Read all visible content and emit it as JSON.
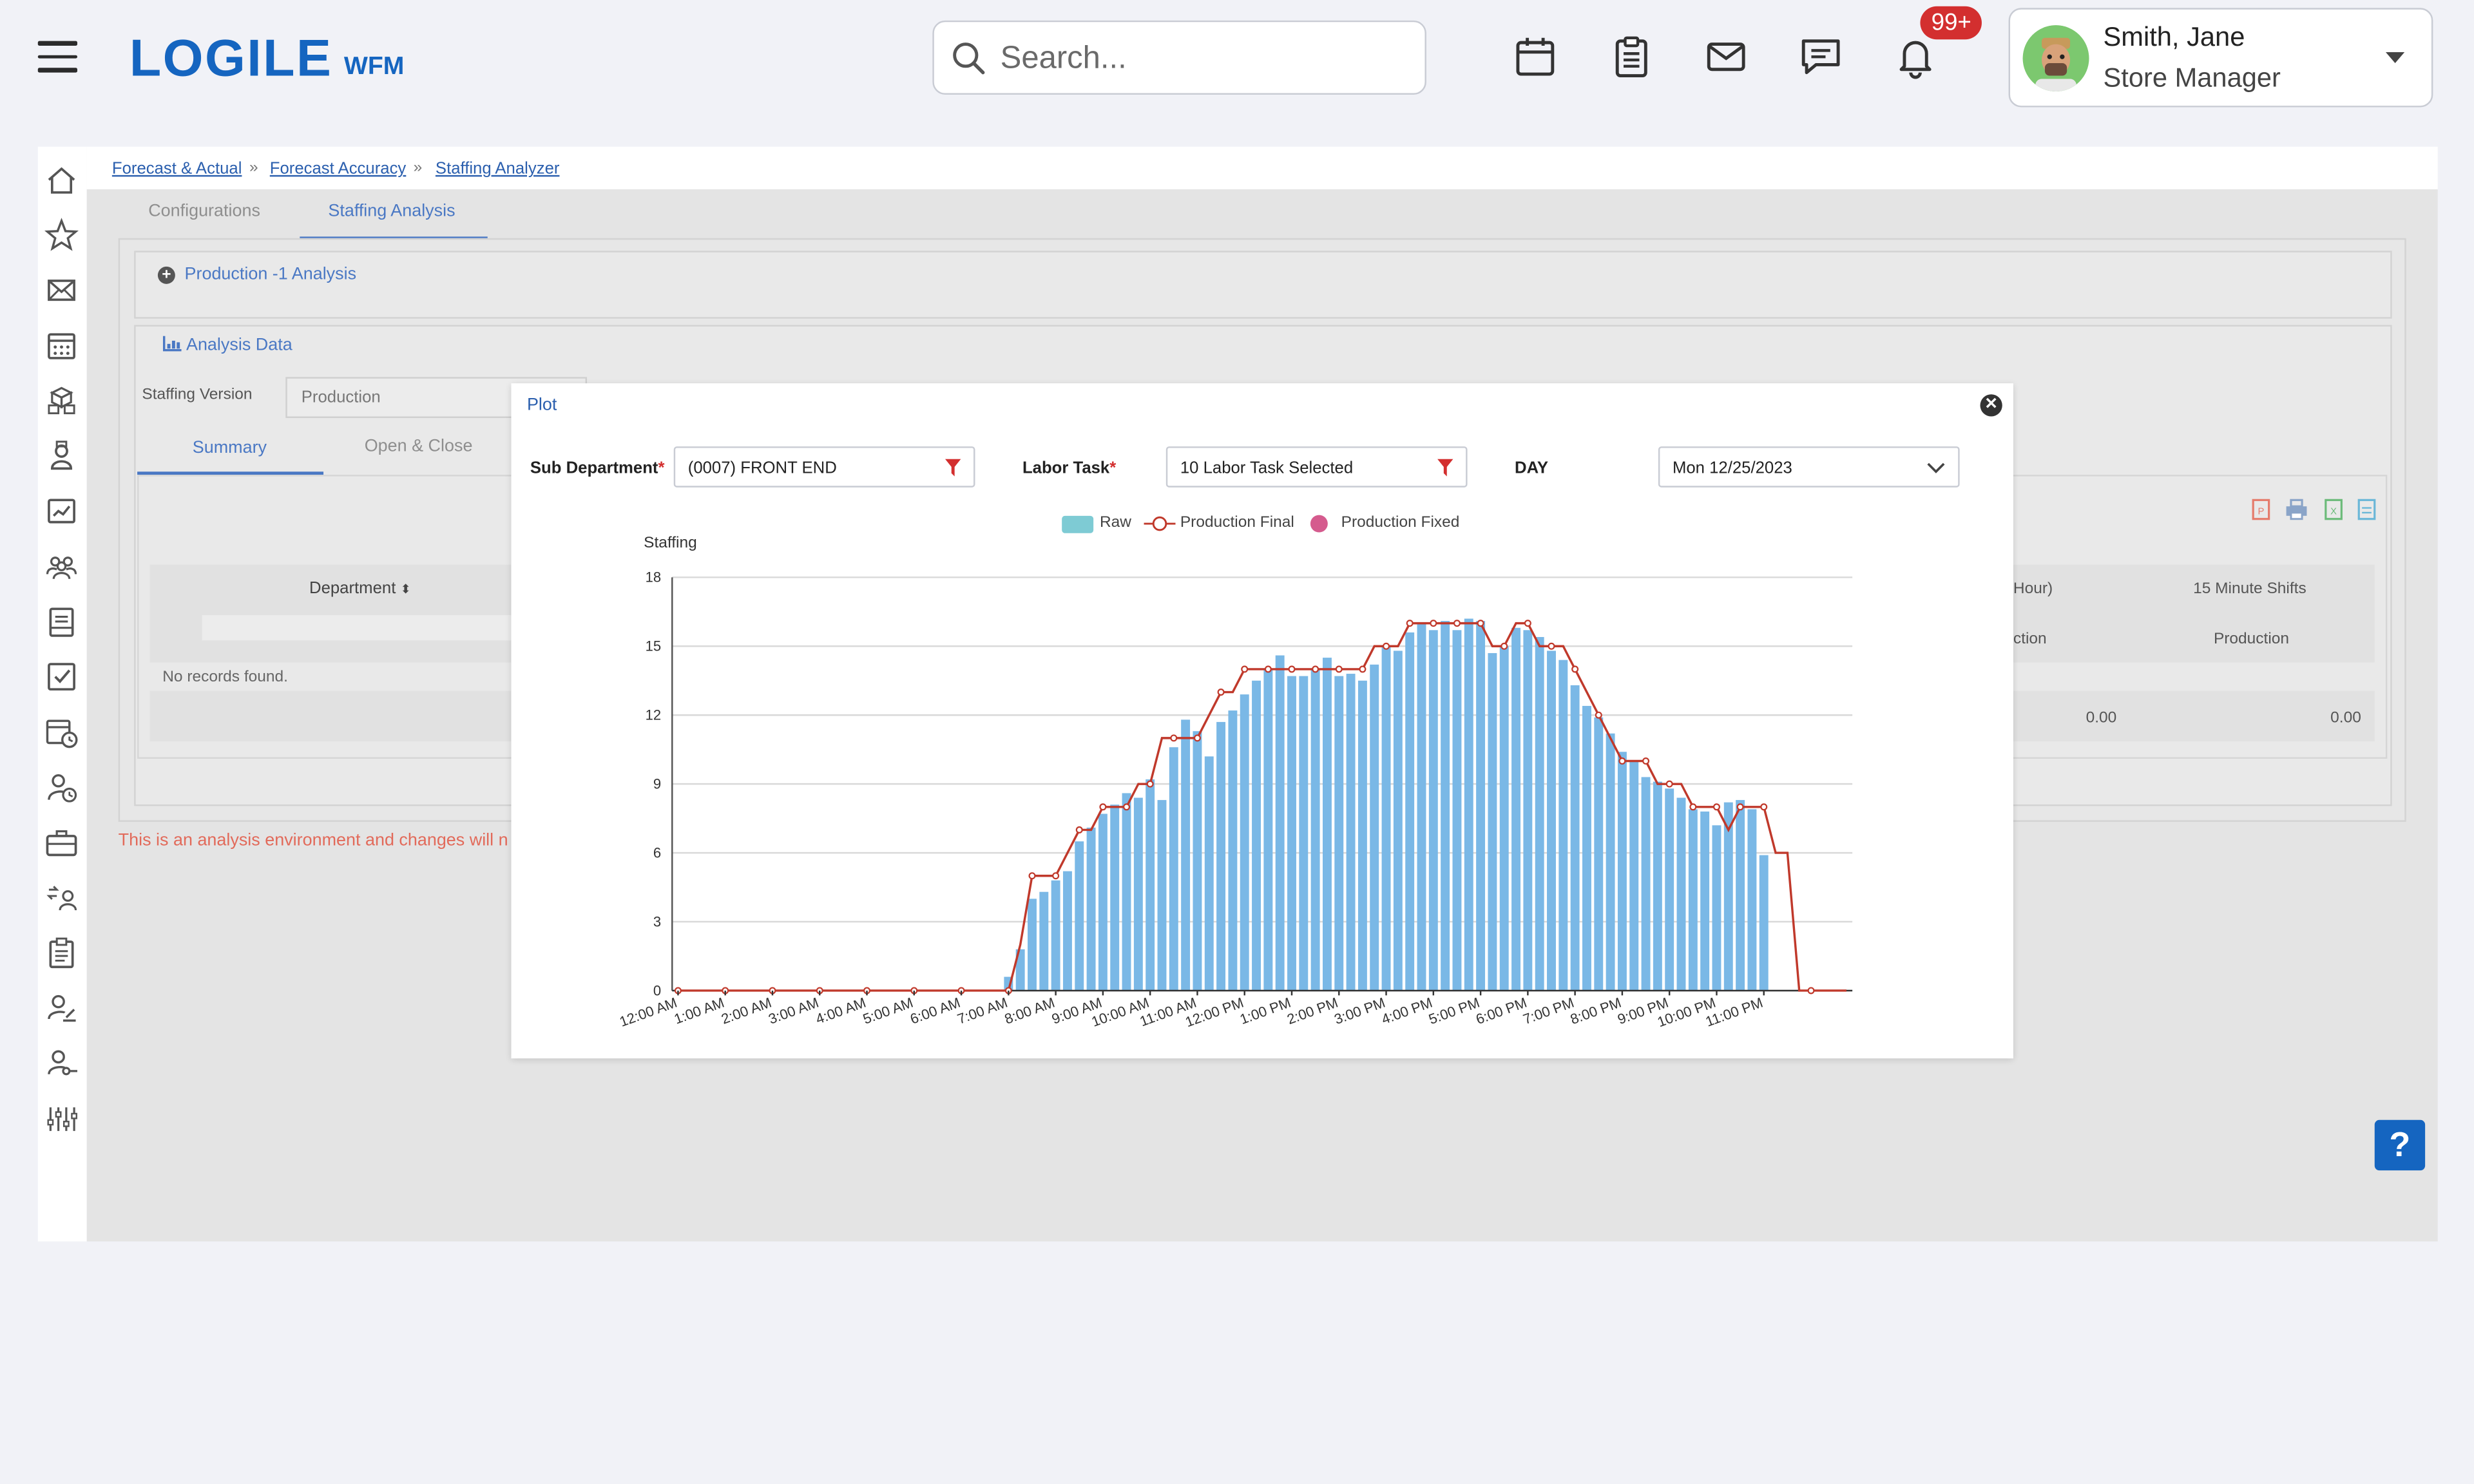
{
  "header": {
    "logo": "LOGILE",
    "logo_sub": "WFM",
    "search_placeholder": "Search...",
    "notification_count": "99+",
    "user_name": "Smith, Jane",
    "user_role": "Store Manager",
    "icons": [
      "calendar-icon",
      "clipboard-icon",
      "mail-icon",
      "chat-icon",
      "bell-icon"
    ]
  },
  "sidebar": {
    "icons": [
      "home-icon",
      "star-icon",
      "envelope-icon",
      "calendar-grid-icon",
      "boxes-icon",
      "person-icon",
      "trend-icon",
      "group-icon",
      "schedule-icon",
      "checkbox-icon",
      "calendar-clock-icon",
      "person-clock-icon",
      "briefcase-icon",
      "person-swap-icon",
      "clipboard-list-icon",
      "person-edit-icon",
      "person-key-icon",
      "sliders-icon"
    ]
  },
  "breadcrumb": [
    "Forecast & Actual",
    "Forecast Accuracy",
    "Staffing Analyzer"
  ],
  "breadcrumb_sep": "»",
  "tabs": [
    "Configurations",
    "Staffing Analysis"
  ],
  "sections": {
    "production_analysis": "Production -1 Analysis",
    "analysis_data": "Analysis Data",
    "staffing_version_label": "Staffing Version",
    "staffing_version_value": "Production",
    "subtabs": [
      "Summary",
      "Open & Close"
    ],
    "table": {
      "dept_header": "Department",
      "no_records": "No records found.",
      "hour_header": "Hour)",
      "shift_header": "15 Minute Shifts",
      "ction": "ction",
      "production": "Production",
      "total1": "0.00",
      "total2": "0.00"
    },
    "warning": "This is an analysis environment and changes will n"
  },
  "modal": {
    "title": "Plot",
    "sub_dept_label": "Sub Department",
    "sub_dept_value": "(0007) FRONT END",
    "labor_task_label": "Labor Task",
    "labor_task_value": "10 Labor Task Selected",
    "day_label": "DAY",
    "day_value": "Mon 12/25/2023",
    "legend": [
      "Raw",
      "Production Final",
      "Production Fixed"
    ],
    "colors": {
      "raw": "#7ab8e6",
      "final": "#c0392b",
      "fixed": "#d55b8e"
    }
  },
  "help_label": "?",
  "chart_data": {
    "type": "bar",
    "ylabel": "Staffing",
    "ylim": [
      0,
      18
    ],
    "yticks": [
      0,
      3,
      6,
      9,
      12,
      15,
      18
    ],
    "x_tick_labels": [
      "12:00 AM",
      "1:00 AM",
      "2:00 AM",
      "3:00 AM",
      "4:00 AM",
      "5:00 AM",
      "6:00 AM",
      "7:00 AM",
      "8:00 AM",
      "9:00 AM",
      "10:00 AM",
      "11:00 AM",
      "12:00 PM",
      "1:00 PM",
      "2:00 PM",
      "3:00 PM",
      "4:00 PM",
      "5:00 PM",
      "6:00 PM",
      "7:00 PM",
      "8:00 PM",
      "9:00 PM",
      "10:00 PM",
      "11:00 PM"
    ],
    "interval": "15 minutes",
    "series": [
      {
        "name": "Raw",
        "type": "bar",
        "values": [
          0,
          0,
          0,
          0,
          0,
          0,
          0,
          0,
          0,
          0,
          0,
          0,
          0,
          0,
          0,
          0,
          0,
          0,
          0,
          0,
          0,
          0,
          0,
          0,
          0,
          0,
          0,
          0,
          0.6,
          1.8,
          4.0,
          4.3,
          4.8,
          5.2,
          6.5,
          7.1,
          7.7,
          8.1,
          8.6,
          8.4,
          9.2,
          8.3,
          10.6,
          11.8,
          11.3,
          10.2,
          11.7,
          12.2,
          12.9,
          13.5,
          14.0,
          14.6,
          13.7,
          13.7,
          14.0,
          14.5,
          13.7,
          13.8,
          13.5,
          14.2,
          15.0,
          14.8,
          15.6,
          16.0,
          15.7,
          16.1,
          15.7,
          16.2,
          16.1,
          14.7,
          15.0,
          15.8,
          15.7,
          15.4,
          14.8,
          14.4,
          13.3,
          12.4,
          11.9,
          11.2,
          10.4,
          10.0,
          9.3,
          9.1,
          8.8,
          8.4,
          7.9,
          7.8,
          7.2,
          8.2,
          8.3,
          7.9,
          5.9,
          0,
          0,
          0,
          0,
          0,
          0,
          0
        ]
      },
      {
        "name": "Production Final",
        "type": "line",
        "values": [
          0,
          0,
          0,
          0,
          0,
          0,
          0,
          0,
          0,
          0,
          0,
          0,
          0,
          0,
          0,
          0,
          0,
          0,
          0,
          0,
          0,
          0,
          0,
          0,
          0,
          0,
          0,
          0,
          0,
          2,
          5,
          5,
          5,
          6,
          7,
          7,
          8,
          8,
          8,
          9,
          9,
          11,
          11,
          11,
          11,
          12,
          13,
          13,
          14,
          14,
          14,
          14,
          14,
          14,
          14,
          14,
          14,
          14,
          14,
          15,
          15,
          15,
          16,
          16,
          16,
          16,
          16,
          16,
          16,
          15,
          15,
          16,
          16,
          15,
          15,
          15,
          14,
          13,
          12,
          11,
          10,
          10,
          10,
          9,
          9,
          9,
          8,
          8,
          8,
          7,
          8,
          8,
          8,
          6,
          6,
          0,
          0,
          0,
          0,
          0
        ]
      },
      {
        "name": "Production Fixed",
        "type": "scatter",
        "values": []
      }
    ]
  }
}
